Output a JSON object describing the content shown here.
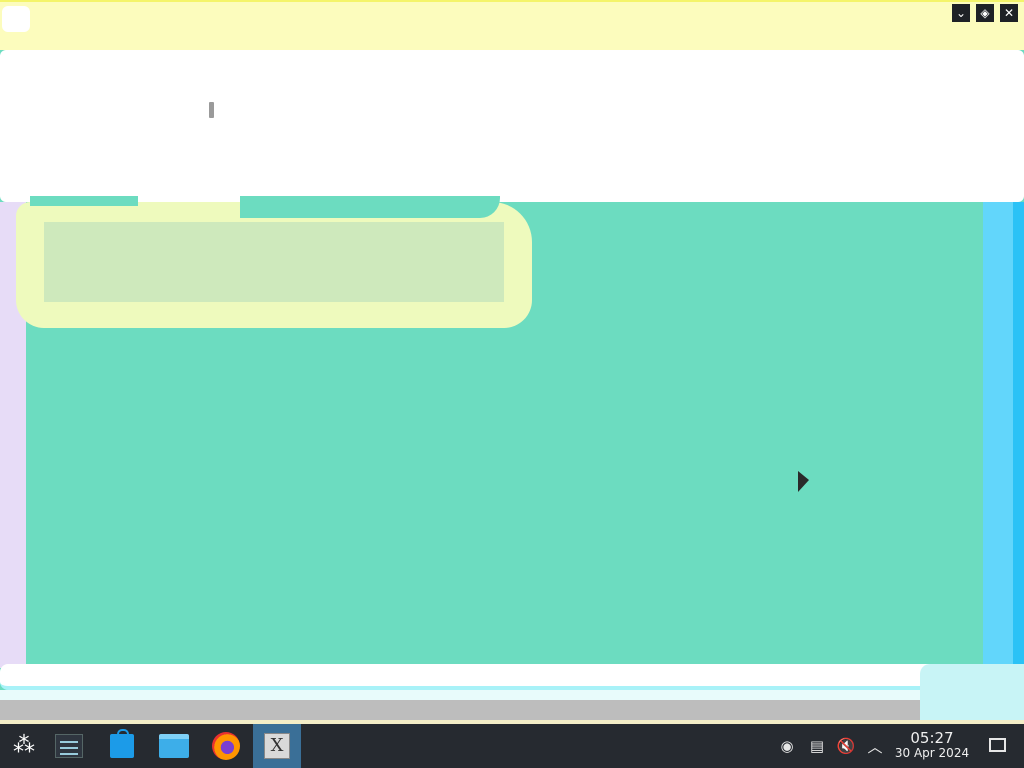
{
  "window": {
    "title_bar_color": "#fcfcbd",
    "buttons": [
      {
        "name": "minimize",
        "icon": "chevron-down-icon",
        "glyph": "⌄"
      },
      {
        "name": "maximize",
        "icon": "diamond-icon",
        "glyph": "◈"
      },
      {
        "name": "close",
        "icon": "close-icon",
        "glyph": "✕"
      }
    ]
  },
  "taskbar": {
    "apps": [
      {
        "name": "application-launcher",
        "icon": "launcher-icon",
        "glyph": "⁂"
      },
      {
        "name": "system-settings",
        "icon": "settings-icon"
      },
      {
        "name": "discover-store",
        "icon": "store-icon"
      },
      {
        "name": "file-manager",
        "icon": "folder-icon"
      },
      {
        "name": "firefox",
        "icon": "firefox-icon"
      },
      {
        "name": "xterm",
        "icon": "xterm-icon",
        "glyph": "X",
        "active": true
      }
    ],
    "tray": [
      {
        "name": "network",
        "icon": "network-icon",
        "glyph": "◉"
      },
      {
        "name": "clipboard",
        "icon": "clipboard-icon",
        "glyph": "▤"
      },
      {
        "name": "volume-muted",
        "icon": "volume-muted-icon",
        "glyph": "🔇"
      },
      {
        "name": "expand-tray",
        "icon": "chevron-up-icon",
        "glyph": "︿"
      }
    ],
    "clock": {
      "time": "05:27",
      "date": "30 Apr 2024"
    }
  },
  "colors": {
    "background": "#6cdcc0",
    "taskbar": "#262a30",
    "active_task": "#3a6f97"
  }
}
